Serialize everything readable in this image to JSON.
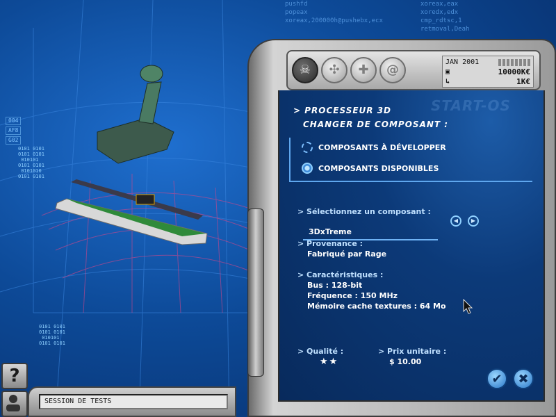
{
  "background": {
    "code_top": "pushfd\npopeax\nxoreax,200000h@pushebx,ecx",
    "code_top2": "xoreax,eax\nxoredx,edx\ncmp_rdtsc,1\nretmoval,Deah",
    "tags": [
      "004",
      "AF8",
      "G02"
    ]
  },
  "device": {
    "date": "JAN 2001",
    "budget": "10000K€",
    "cost": "1K€",
    "icons": [
      "skull-icon",
      "processor-icon",
      "gamepad-icon",
      "at-sign-icon"
    ],
    "watermark": "START-OS"
  },
  "screen": {
    "heading_1": "> PROCESSEUR 3D",
    "heading_2": "CHANGER DE COMPOSANT :",
    "options": [
      {
        "label": "COMPOSANTS À DÉVELOPPER",
        "selected": false
      },
      {
        "label": "COMPOSANTS DISPONIBLES",
        "selected": true
      }
    ],
    "select_label": "> Sélectionnez un composant :",
    "select_value": "3DxTreme",
    "origin_label": "> Provenance :",
    "origin_value": "Fabriqué par Rage",
    "specs_label": "> Caractéristiques :",
    "specs": [
      "Bus : 128-bit",
      "Fréquence : 150 MHz",
      "Mémoire cache textures : 64 Mo"
    ],
    "quality_label": "> Qualité :",
    "quality_stars": 2,
    "quality_display": "★★",
    "price_label": "> Prix unitaire :",
    "price_value": "$ 10.00"
  },
  "bottom": {
    "help": "?",
    "session": "SESSION DE TESTS"
  }
}
